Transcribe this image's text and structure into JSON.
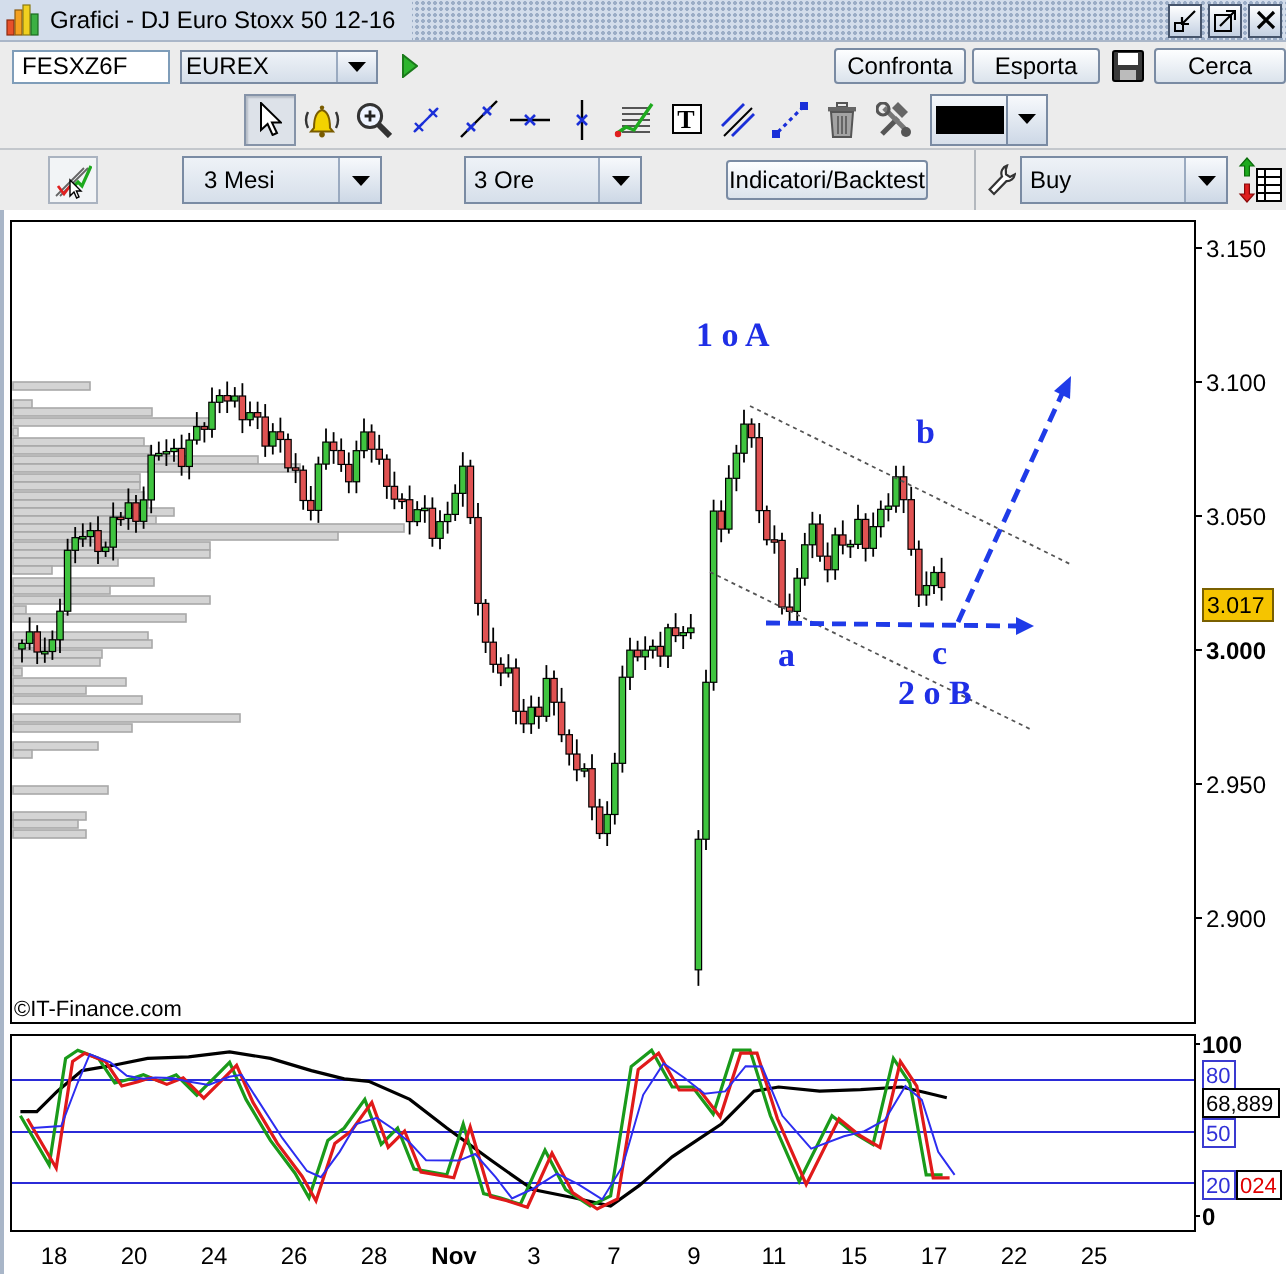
{
  "window": {
    "title": "Grafici - DJ Euro Stoxx 50 12-16"
  },
  "symbol_bar": {
    "symbol": "FESXZ6F",
    "exchange": "EUREX",
    "buttons": [
      {
        "kind": "text",
        "label": "Confronta"
      },
      {
        "kind": "text",
        "label": "Esporta"
      },
      {
        "kind": "save"
      },
      {
        "kind": "text",
        "label": "Cerca"
      }
    ]
  },
  "drawing_toolbar": {
    "tools": [
      {
        "kind": "pointer",
        "selected": true
      },
      {
        "kind": "alert",
        "selected": false
      },
      {
        "kind": "zoom",
        "selected": false
      },
      {
        "kind": "segment",
        "selected": false
      },
      {
        "kind": "line",
        "selected": false
      },
      {
        "kind": "horizontal",
        "selected": false
      },
      {
        "kind": "vertical",
        "selected": false
      },
      {
        "kind": "fibonacci",
        "selected": false
      },
      {
        "kind": "text",
        "label": "T",
        "selected": false
      },
      {
        "kind": "parallel",
        "selected": false
      },
      {
        "kind": "dashed",
        "selected": false
      },
      {
        "kind": "delete",
        "selected": false
      },
      {
        "kind": "settings",
        "selected": false
      }
    ]
  },
  "period_bar": {
    "range": "3 Mesi",
    "interval": "3 Ore",
    "indicators_button": "Indicatori/Backtest",
    "order_type": "Buy"
  },
  "price_chart": {
    "price_axis": [
      {
        "label": "3.150",
        "kind": "fraction"
      },
      {
        "label": "3.100",
        "kind": "fraction"
      },
      {
        "label": "3.050",
        "kind": "fraction"
      },
      {
        "label": "3.000",
        "kind": "whole"
      },
      {
        "label": "2.950",
        "kind": "fraction"
      },
      {
        "label": "2.900",
        "kind": "fraction"
      }
    ],
    "last_price": "3.017",
    "wave_labels": [
      "1 o A",
      "b",
      "a",
      "c",
      "2 o B"
    ],
    "copyright": "©IT-Finance.com"
  },
  "oscillator": {
    "axis_ticks": [
      "100",
      "0"
    ],
    "level_labels": [
      "80",
      "50",
      "20"
    ],
    "readings": [
      {
        "value": "68,889",
        "color": "#000000"
      },
      {
        "value": "024",
        "color": "#e00000"
      }
    ]
  },
  "time_axis": [
    {
      "label": "18",
      "kind": "day"
    },
    {
      "label": "20",
      "kind": "day"
    },
    {
      "label": "24",
      "kind": "day"
    },
    {
      "label": "26",
      "kind": "day"
    },
    {
      "label": "28",
      "kind": "day"
    },
    {
      "label": "Nov",
      "kind": "month"
    },
    {
      "label": "3",
      "kind": "day"
    },
    {
      "label": "7",
      "kind": "day"
    },
    {
      "label": "9",
      "kind": "day"
    },
    {
      "label": "11",
      "kind": "day"
    },
    {
      "label": "15",
      "kind": "day"
    },
    {
      "label": "17",
      "kind": "day"
    },
    {
      "label": "22",
      "kind": "day"
    },
    {
      "label": "25",
      "kind": "day"
    }
  ]
}
